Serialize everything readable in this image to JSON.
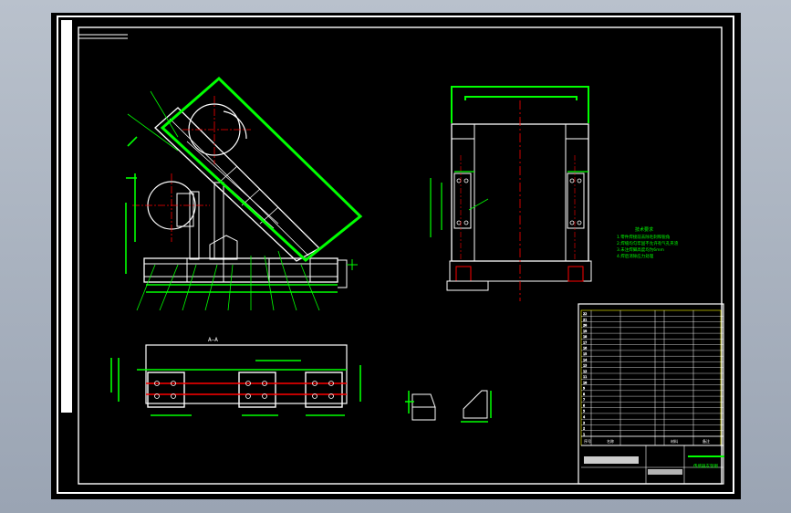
{
  "colors": {
    "background": "#000000",
    "outline": "#ffffff",
    "dimension": "#00ff00",
    "centerline": "#ff0000",
    "hatch": "#ffffff",
    "titleblock_accent": "#ffff00",
    "viewport_bg": "#a9b2bf"
  },
  "drawing": {
    "section_label": "A—A",
    "title_text": "传感器支架图"
  },
  "notes": {
    "heading": "技术要求",
    "items": [
      "1.零件焊接前去除毛刺和锐角",
      "2.焊缝均匀牢固不允许有气孔夹渣",
      "3.未注焊脚高度均为6mm",
      "4.焊后消除应力处理"
    ]
  },
  "titleblock": {
    "rows": [
      "22",
      "21",
      "20",
      "19",
      "18",
      "17",
      "16",
      "15",
      "14",
      "13",
      "12",
      "11",
      "10",
      "9",
      "8",
      "7",
      "6",
      "5",
      "4",
      "3",
      "2",
      "1"
    ],
    "headers": [
      "序号",
      "名称",
      "材料",
      "备注"
    ]
  }
}
